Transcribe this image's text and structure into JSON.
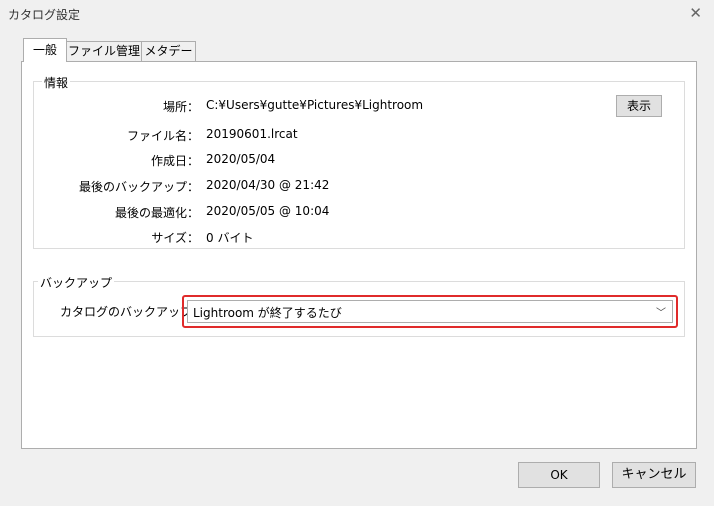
{
  "window": {
    "title": "カタログ設定",
    "close_glyph": "✕"
  },
  "tabs": [
    {
      "label": "一般",
      "active": true
    },
    {
      "label": "ファイル管理",
      "active": false
    },
    {
      "label": "メタデータ",
      "active": false
    }
  ],
  "info": {
    "legend": "情報",
    "rows": [
      {
        "label": "場所：",
        "value": "C:¥Users¥gutte¥Pictures¥Lightroom"
      },
      {
        "label": "ファイル名：",
        "value": "20190601.lrcat"
      },
      {
        "label": "作成日：",
        "value": "2020/05/04"
      },
      {
        "label": "最後のバックアップ：",
        "value": "2020/04/30 @ 21:42"
      },
      {
        "label": "最後の最適化：",
        "value": "2020/05/05 @ 10:04"
      },
      {
        "label": "サイズ：",
        "value": "0 バイト"
      }
    ],
    "show_button": "表示"
  },
  "backup": {
    "legend": "バックアップ",
    "label": "カタログのバックアップ：",
    "selected": "Lightroom が終了するたび",
    "highlight_color": "#e02b2b"
  },
  "footer": {
    "ok": "OK",
    "cancel": "キャンセル"
  },
  "icons": {
    "close": "close-icon",
    "dropdown": "chevron-down-icon"
  }
}
